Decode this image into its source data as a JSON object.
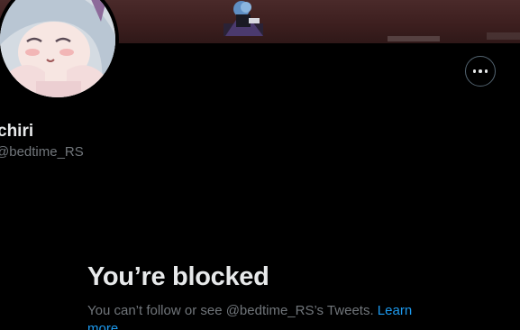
{
  "profile": {
    "display_name": "chiri",
    "handle": "@bedtime_RS",
    "avatar_icon": "profile-avatar",
    "banner_icon": "profile-banner"
  },
  "header": {
    "more_icon": "more-options-icon"
  },
  "blocked": {
    "title": "You’re blocked",
    "body": "You can’t follow or see @bedtime_RS’s Tweets.",
    "learn_more": "Learn more"
  },
  "colors": {
    "background": "#000000",
    "primary_text": "#e7e9ea",
    "secondary_text": "#71767b",
    "link": "#1d9bf0",
    "border": "#536471"
  }
}
